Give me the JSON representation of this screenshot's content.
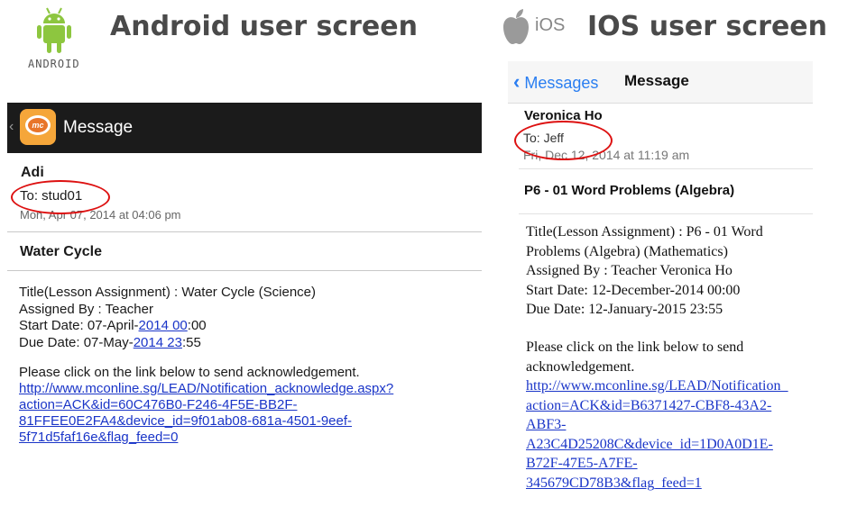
{
  "android_header": {
    "title": "Android user screen",
    "logo_text": "ANDROID"
  },
  "ios_header": {
    "title": "IOS user screen",
    "badge": "iOS"
  },
  "android": {
    "topbar_title": "Message",
    "sender": "Adi",
    "to": "To: stud01",
    "date": "Mon, Apr 07, 2014 at 04:06 pm",
    "subject": "Water Cycle",
    "body_line1": "Title(Lesson Assignment) : Water Cycle (Science)",
    "body_line2": "Assigned By : Teacher",
    "start_prefix": "Start Date: 07-April-",
    "start_link": "2014 00",
    "start_suffix": ":00",
    "due_prefix": "Due Date: 07-May-",
    "due_link": "2014 23",
    "due_suffix": ":55",
    "ack_text": "Please click on the link below to send acknowledgement.",
    "link_lines": [
      "http://www.mconline.sg/LEAD/Notification_acknowledge.aspx?",
      "action=ACK&id=60C476B0-F246-4F5E-BB2F-",
      "81FFEE0E2FA4&device_id=9f01ab08-681a-4501-9eef-",
      "5f71d5faf16e&flag_feed=0"
    ]
  },
  "ios": {
    "nav_back": "Messages",
    "nav_title": "Message",
    "sender": "Veronica Ho",
    "to": "To: Jeff",
    "date": "Fri, Dec 12, 2014 at 11:19 am",
    "subject": "P6 - 01 Word Problems (Algebra)",
    "body_lines": [
      "Title(Lesson Assignment) : P6 - 01 Word",
      "Problems (Algebra) (Mathematics)",
      "Assigned By : Teacher Veronica Ho",
      "Start Date: 12-December-2014 00:00",
      "Due Date: 12-January-2015 23:55"
    ],
    "ack_lines": [
      "Please click on the link below to send",
      "acknowledgement."
    ],
    "link_lines": [
      "http://www.mconline.sg/LEAD/Notification_",
      "action=ACK&id=B6371427-CBF8-43A2-",
      "ABF3-",
      "A23C4D25208C&device_id=1D0A0D1E-",
      "B72F-47E5-A7FE-",
      "345679CD78B3&flag_feed=1"
    ]
  },
  "colors": {
    "android_green": "#8dc63f",
    "red_annotation": "#d11111",
    "link_blue": "#1a35c8",
    "ios_blue": "#2a7ef1",
    "app_orange": "#f5a63a"
  }
}
